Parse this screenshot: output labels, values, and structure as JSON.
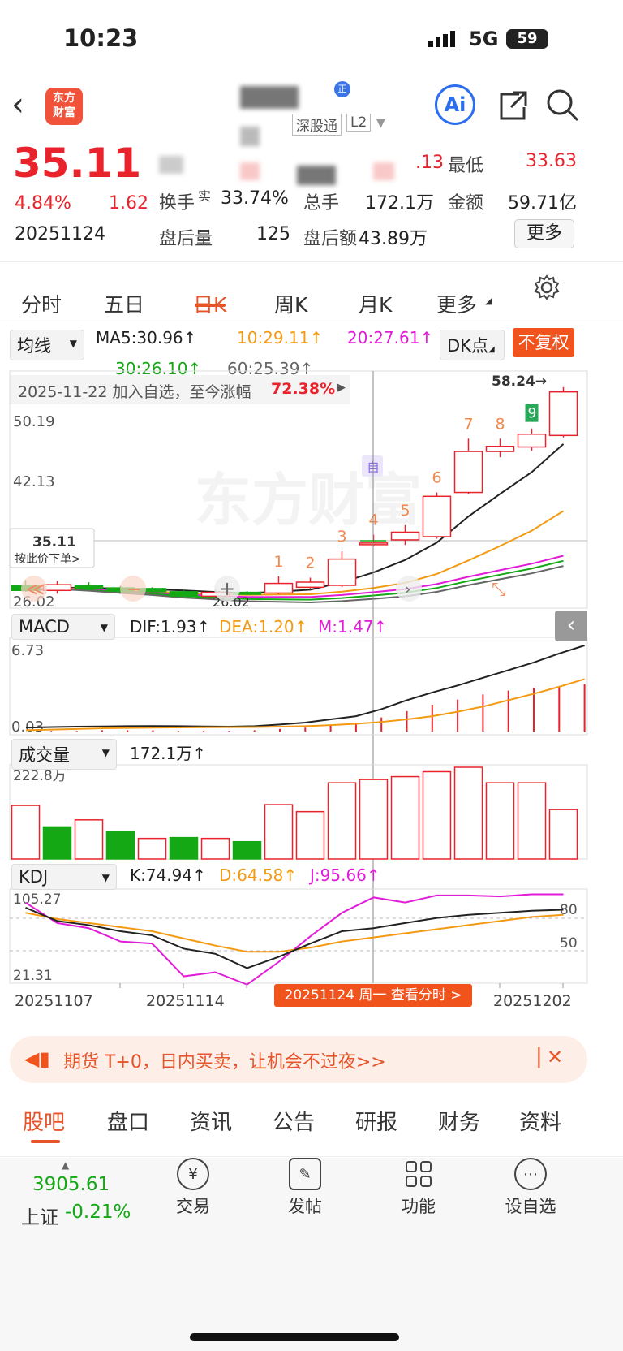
{
  "status": {
    "time": "10:23",
    "network": "5G",
    "battery": "59"
  },
  "header": {
    "stock_connect": "深股通",
    "level": "L2",
    "ai_label": "Ai"
  },
  "quote": {
    "price": "35.11",
    "change_pct": "4.84%",
    "change": "1.62",
    "date": "20251124",
    "high_value": ".13",
    "low_label": "最低",
    "low_value": "33.63",
    "turnover_label": "换手",
    "turnover_sup": "实",
    "turnover_value": "33.74%",
    "volume_label": "总手",
    "volume_value": "172.1万",
    "amount_label": "金额",
    "amount_value": "59.71亿",
    "after_vol_label": "盘后量",
    "after_vol_value": "125",
    "after_amt_label": "盘后额",
    "after_amt_value": "43.89万",
    "more_label": "更多"
  },
  "period_tabs": [
    "分时",
    "五日",
    "日K",
    "周K",
    "月K",
    "更多"
  ],
  "active_tab": "日K",
  "ma": {
    "selector": "均线",
    "ma5": "MA5:30.96↑",
    "ma10": "10:29.11↑",
    "ma20": "20:27.61↑",
    "ma30": "30:26.10↑",
    "ma60": "60:25.39↑",
    "dk": "DK点",
    "adjust": "不复权",
    "colors": {
      "ma5": "#222222",
      "ma10": "#f39a12",
      "ma20": "#e21bd8",
      "ma30": "#14a814",
      "ma60": "#666666"
    }
  },
  "banner": {
    "text": "2025-11-22 加入自选，至今涨幅",
    "pct": "72.38%"
  },
  "kline": {
    "y_top": "50.19",
    "y_mid": "42.13",
    "y_bottom": "26.02",
    "price_tag": "35.11",
    "price_tag_sub": "按此价下单>",
    "max_label": "58.24→",
    "min_label": "26.02",
    "watermark": "东方财富",
    "self_tag": "自",
    "candles": [
      {
        "o": 27.3,
        "c": 26.5,
        "h": 28.1,
        "l": 26.3
      },
      {
        "o": 26.5,
        "c": 27.4,
        "h": 28.0,
        "l": 26.0
      },
      {
        "o": 27.3,
        "c": 26.8,
        "h": 27.8,
        "l": 26.5
      },
      {
        "o": 26.9,
        "c": 26.4,
        "h": 27.2,
        "l": 26.1
      },
      {
        "o": 26.8,
        "c": 26.3,
        "h": 27.0,
        "l": 26.0
      },
      {
        "o": 26.3,
        "c": 25.6,
        "h": 26.5,
        "l": 25.5
      },
      {
        "o": 25.6,
        "c": 26.2,
        "h": 26.6,
        "l": 25.5
      },
      {
        "o": 26.2,
        "c": 25.9,
        "h": 26.4,
        "l": 25.8
      },
      {
        "o": 26.1,
        "c": 27.6,
        "h": 28.7,
        "l": 25.9
      },
      {
        "o": 27.0,
        "c": 27.8,
        "h": 28.5,
        "l": 26.8
      },
      {
        "o": 27.3,
        "c": 31.4,
        "h": 32.6,
        "l": 27.0
      },
      {
        "o": 33.9,
        "c": 33.9,
        "h": 35.2,
        "l": 33.4
      },
      {
        "o": 34.4,
        "c": 35.6,
        "h": 36.7,
        "l": 33.6
      },
      {
        "o": 34.9,
        "c": 41.2,
        "h": 41.8,
        "l": 34.6
      },
      {
        "o": 41.8,
        "c": 48.2,
        "h": 50.2,
        "l": 41.6
      },
      {
        "o": 48.2,
        "c": 49.0,
        "h": 50.2,
        "l": 47.3
      },
      {
        "o": 48.9,
        "c": 50.9,
        "h": 51.8,
        "l": 48.3
      },
      {
        "o": 50.7,
        "c": 57.5,
        "h": 58.24,
        "l": 50.4
      }
    ],
    "markers": [
      "1",
      "2",
      "3",
      "4",
      "5",
      "6",
      "7",
      "8",
      "9"
    ]
  },
  "macd": {
    "selector": "MACD",
    "dif": "DIF:1.93↑",
    "dea": "DEA:1.20↑",
    "m": "M:1.47↑",
    "y_top": "6.73",
    "y_bottom": "0.03",
    "dif_values": [
      0.3,
      0.35,
      0.38,
      0.4,
      0.42,
      0.43,
      0.42,
      0.4,
      0.38,
      0.42,
      0.55,
      0.7,
      0.95,
      1.2,
      1.75,
      2.45,
      3.05,
      3.6,
      4.2,
      4.8,
      5.4,
      6.1,
      6.73
    ],
    "dea_values": [
      0.1,
      0.15,
      0.2,
      0.25,
      0.28,
      0.3,
      0.32,
      0.33,
      0.34,
      0.35,
      0.38,
      0.42,
      0.5,
      0.6,
      0.75,
      0.95,
      1.2,
      1.55,
      1.95,
      2.45,
      2.95,
      3.5,
      4.1
    ],
    "bars": [
      0.0,
      0.05,
      0.05,
      0.1,
      0.1,
      0.1,
      0.05,
      0.05,
      0.05,
      0.1,
      0.2,
      0.3,
      0.5,
      0.7,
      1.1,
      1.6,
      2.1,
      2.5,
      2.9,
      3.2,
      3.4,
      3.5,
      3.7
    ]
  },
  "volume": {
    "selector": "成交量",
    "value": "172.1万↑",
    "y_top": "222.8万",
    "bars": [
      {
        "v": 130,
        "up": true
      },
      {
        "v": 78,
        "up": false
      },
      {
        "v": 95,
        "up": true
      },
      {
        "v": 66,
        "up": false
      },
      {
        "v": 50,
        "up": true
      },
      {
        "v": 52,
        "up": false
      },
      {
        "v": 50,
        "up": true
      },
      {
        "v": 42,
        "up": false
      },
      {
        "v": 132,
        "up": true
      },
      {
        "v": 115,
        "up": true
      },
      {
        "v": 185,
        "up": true
      },
      {
        "v": 193,
        "up": true
      },
      {
        "v": 200,
        "up": true
      },
      {
        "v": 212,
        "up": true
      },
      {
        "v": 222.8,
        "up": true
      },
      {
        "v": 185,
        "up": true
      },
      {
        "v": 185,
        "up": true
      },
      {
        "v": 120,
        "up": true
      }
    ]
  },
  "kdj": {
    "selector": "KDJ",
    "k": "K:74.94↑",
    "d": "D:64.58↑",
    "j": "J:95.66↑",
    "y_top": "105.27",
    "y_bottom": "21.31",
    "ref_80": "80",
    "ref_50": "50",
    "k_values": [
      95,
      82,
      78,
      72,
      68,
      55,
      50,
      36,
      47,
      60,
      72,
      75,
      80,
      85,
      88,
      90,
      92,
      93
    ],
    "d_values": [
      90,
      84,
      80,
      76,
      72,
      65,
      58,
      52,
      52,
      56,
      62,
      66,
      70,
      74,
      78,
      82,
      86,
      88
    ],
    "j_values": [
      100,
      80,
      75,
      62,
      60,
      28,
      32,
      20,
      42,
      67,
      90,
      105,
      100,
      107,
      107,
      106,
      108,
      108
    ]
  },
  "x_axis": {
    "labels": [
      "20251107",
      "20251114",
      "20251202"
    ],
    "tooltip": "20251124 周一 查看分时 >"
  },
  "promo": {
    "text": "期货 T+0，日内买卖，让机会不过夜>>"
  },
  "bottom_tabs": [
    "股吧",
    "盘口",
    "资讯",
    "公告",
    "研报",
    "财务",
    "资料"
  ],
  "index": {
    "value": "3905.61",
    "name": "上证",
    "change": "-0.21%"
  },
  "toolbar": {
    "trade": "交易",
    "post": "发帖",
    "func": "功能",
    "watch": "设自选"
  }
}
